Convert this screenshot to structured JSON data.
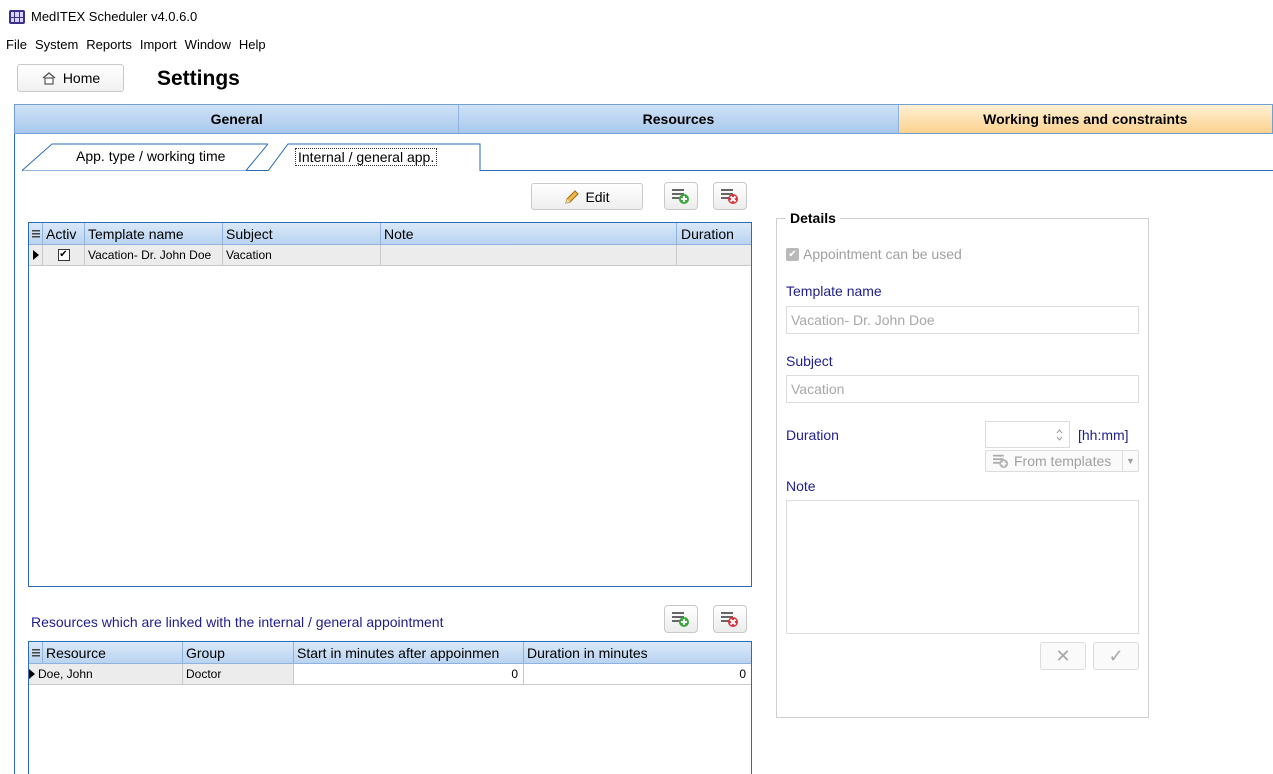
{
  "window": {
    "title": "MedITEX Scheduler v4.0.6.0"
  },
  "menu": [
    "File",
    "System",
    "Reports",
    "Import",
    "Window",
    "Help"
  ],
  "header": {
    "home_label": "Home",
    "page_title": "Settings"
  },
  "top_tabs": [
    {
      "label": "General",
      "active": false
    },
    {
      "label": "Resources",
      "active": false
    },
    {
      "label": "Working times and constraints",
      "active": true
    }
  ],
  "sub_tabs": [
    {
      "label": "App. type / working time",
      "active": false
    },
    {
      "label": "Internal / general app.",
      "active": true
    }
  ],
  "toolbar": {
    "edit_label": "Edit"
  },
  "templates": {
    "columns": [
      "Activ",
      "Template name",
      "Subject",
      "Note",
      "Duration"
    ],
    "rows": [
      {
        "active": true,
        "template_name": "Vacation- Dr. John Doe",
        "subject": "Vacation",
        "note": "",
        "duration": ""
      }
    ]
  },
  "resources": {
    "caption": "Resources which are linked with the internal / general appointment",
    "columns": [
      "Resource",
      "Group",
      "Start in minutes after appoinmen",
      "Duration in minutes"
    ],
    "rows": [
      {
        "resource": "Doe, John",
        "group": "Doctor",
        "start": "0",
        "duration": "0"
      }
    ]
  },
  "details": {
    "legend": "Details",
    "usable_label": "Appointment can be used",
    "template_name_label": "Template name",
    "template_name_value": "Vacation- Dr. John Doe",
    "subject_label": "Subject",
    "subject_value": "Vacation",
    "duration_label": "Duration",
    "duration_unit": "[hh:mm]",
    "from_templates_label": "From templates",
    "note_label": "Note"
  },
  "colors": {
    "accent_blue": "#2a6cb8",
    "active_tab": "#fbd28e",
    "label_blue": "#1e1e8c"
  }
}
